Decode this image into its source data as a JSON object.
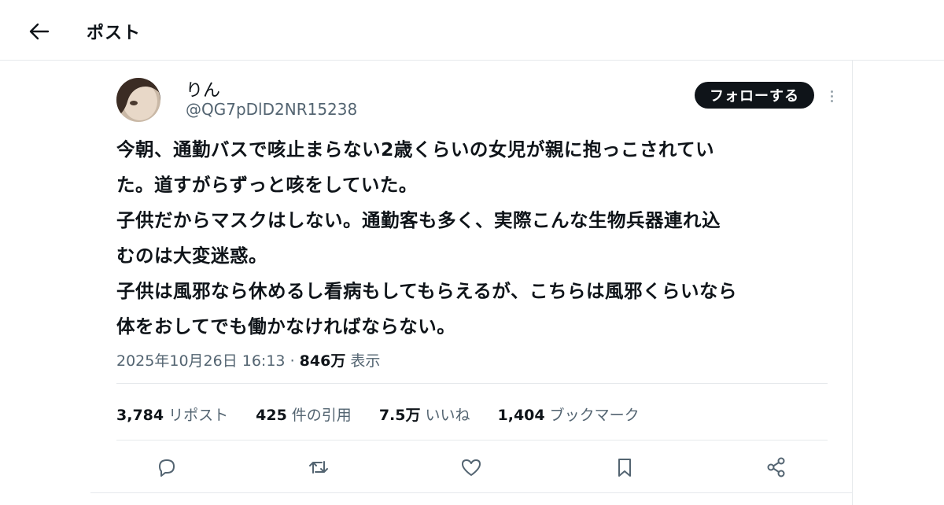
{
  "header": {
    "back_icon": "arrow-left-icon",
    "title": "ポスト"
  },
  "author": {
    "display_name": "りん",
    "handle": "@QG7pDlD2NR15238",
    "follow_label": "フォローする",
    "more_icon": "more-vertical-icon"
  },
  "tweet": {
    "lines": [
      "今朝、通勤バスで咳止まらない2歳くらいの女児が親に抱っこされてい",
      "た。道すがらずっと咳をしていた。",
      "子供だからマスクはしない。通勤客も多く、実際こんな生物兵器連れ込",
      "むのは大変迷惑。",
      "子供は風邪なら休めるし看病もしてもらえるが、こちらは風邪くらいなら",
      "体をおしてでも働かなければならない。"
    ]
  },
  "meta": {
    "timestamp": "2025年10月26日 16:13",
    "separator": "·",
    "views": "846万",
    "views_label": "表示"
  },
  "stats": [
    {
      "count": "3,784",
      "label": "リポスト"
    },
    {
      "count": "425",
      "label": "件の引用"
    },
    {
      "count": "7.5万",
      "label": "いいね"
    },
    {
      "count": "1,404",
      "label": "ブックマーク"
    }
  ],
  "actions": [
    {
      "icon": "reply-icon"
    },
    {
      "icon": "repost-icon"
    },
    {
      "icon": "like-icon"
    },
    {
      "icon": "bookmark-icon"
    },
    {
      "icon": "share-icon"
    }
  ],
  "colors": {
    "text": "#0f1419",
    "secondary": "#536471",
    "border": "#e6e9ec",
    "button_bg": "#0f1419",
    "icon": "#536471"
  }
}
